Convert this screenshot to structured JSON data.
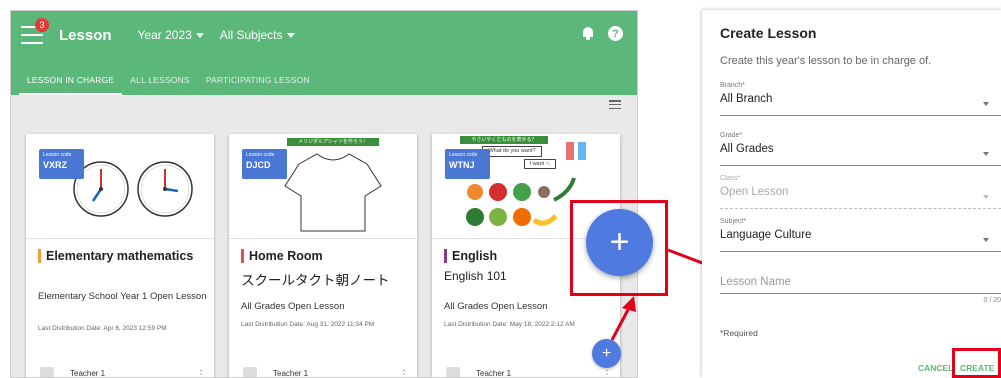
{
  "header": {
    "badge_count": "3",
    "app_title": "Lesson",
    "year_dropdown": "Year 2023",
    "subject_dropdown": "All Subjects",
    "bell_icon": "bell-icon",
    "help_icon": "help-icon",
    "help_glyph": "?"
  },
  "tabs": [
    {
      "label": "LESSON IN CHARGE"
    },
    {
      "label": "ALL LESSONS"
    },
    {
      "label": "PARTICIPATING LESSON"
    }
  ],
  "cards": [
    {
      "code_label": "Lesson code",
      "code": "VXRZ",
      "title": "Elementary mathematics",
      "desc": "Elementary School Year 1 Open Lesson",
      "date": "Last Distribution Date: Apr 6, 2023 12:59 PM",
      "teacher": "Teacher 1",
      "accent": "#f0a030"
    },
    {
      "code_label": "Lesson code",
      "code": "DJCD",
      "banner": "メリジダルアシャツを作ろう！",
      "title": "Home Room",
      "subtitle": "スクールタクト朝ノート",
      "desc": "All Grades Open Lesson",
      "date": "Last Distribution Date: Aug 31, 2022 11:34 PM",
      "teacher": "Teacher 1",
      "accent": "#d9534f"
    },
    {
      "code_label": "Lesson code",
      "code": "WTNJ",
      "banner": "やさいやくだものを表せる？",
      "bubble1": "What do you want?",
      "bubble2": "I want ~.",
      "title": "English",
      "subtitle": "English 101",
      "desc": "All Grades Open Lesson",
      "date": "Last Distribution Date: May 18, 2022 2:12 AM",
      "teacher": "Teacher 1",
      "accent": "#8e3b8e"
    }
  ],
  "fab": {
    "glyph": "+"
  },
  "dialog": {
    "title": "Create Lesson",
    "subtitle": "Create this year's lesson to be in charge of.",
    "fields": [
      {
        "label": "Branch*",
        "value": "All Branch"
      },
      {
        "label": "Grade*",
        "value": "All Grades"
      },
      {
        "label": "Class*",
        "value": "Open Lesson"
      },
      {
        "label": "Subject*",
        "value": "Language Culture"
      }
    ],
    "lesson_name_placeholder": "Lesson Name",
    "counter": "0 / 20",
    "required_note": "*Required",
    "cancel_label": "CANCEL",
    "create_label": "CREATE"
  },
  "colors": {
    "header_green": "#5cb87a",
    "code_blue": "#4a76d4",
    "fab_blue": "#4f7be0",
    "highlight_red": "#e3001b"
  }
}
